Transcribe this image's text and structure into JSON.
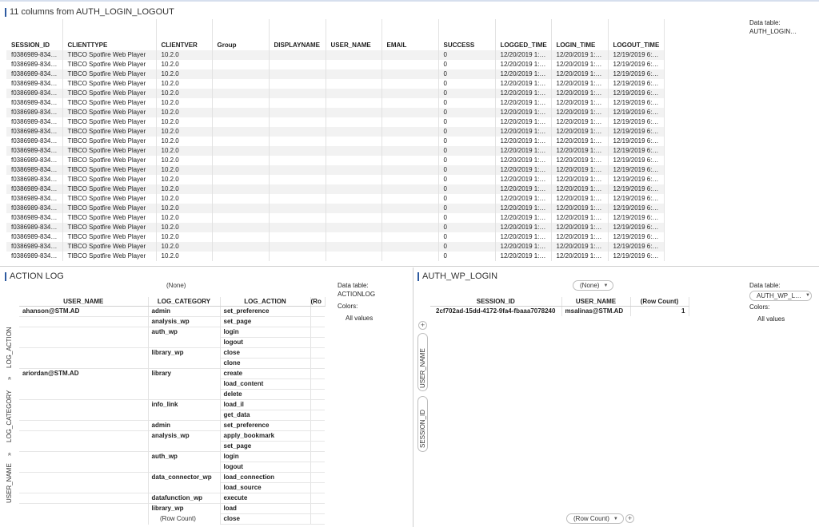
{
  "top": {
    "title": "11 columns from AUTH_LOGIN_LOGOUT",
    "data_table_label": "Data table:",
    "data_table_value": "AUTH_LOGIN…",
    "columns": [
      "SESSION_ID",
      "CLIENTTYPE",
      "CLIENTVER",
      "Group",
      "DISPLAYNAME",
      "USER_NAME",
      "EMAIL",
      "SUCCESS",
      "LOGGED_TIME",
      "LOGIN_TIME",
      "LOGOUT_TIME"
    ],
    "rows": [
      [
        "f0386989-834…",
        "TIBCO Spotfire Web Player",
        "10.2.0",
        "",
        "",
        "",
        "",
        "0",
        "12/20/2019 1:…",
        "12/20/2019 1:…",
        "12/19/2019 6:…"
      ],
      [
        "f0386989-834…",
        "TIBCO Spotfire Web Player",
        "10.2.0",
        "",
        "",
        "",
        "",
        "0",
        "12/20/2019 1:…",
        "12/20/2019 1:…",
        "12/19/2019 6:…"
      ],
      [
        "f0386989-834…",
        "TIBCO Spotfire Web Player",
        "10.2.0",
        "",
        "",
        "",
        "",
        "0",
        "12/20/2019 1:…",
        "12/20/2019 1:…",
        "12/19/2019 6:…"
      ],
      [
        "f0386989-834…",
        "TIBCO Spotfire Web Player",
        "10.2.0",
        "",
        "",
        "",
        "",
        "0",
        "12/20/2019 1:…",
        "12/20/2019 1:…",
        "12/19/2019 6:…"
      ],
      [
        "f0386989-834…",
        "TIBCO Spotfire Web Player",
        "10.2.0",
        "",
        "",
        "",
        "",
        "0",
        "12/20/2019 1:…",
        "12/20/2019 1:…",
        "12/19/2019 6:…"
      ],
      [
        "f0386989-834…",
        "TIBCO Spotfire Web Player",
        "10.2.0",
        "",
        "",
        "",
        "",
        "0",
        "12/20/2019 1:…",
        "12/20/2019 1:…",
        "12/19/2019 6:…"
      ],
      [
        "f0386989-834…",
        "TIBCO Spotfire Web Player",
        "10.2.0",
        "",
        "",
        "",
        "",
        "0",
        "12/20/2019 1:…",
        "12/20/2019 1:…",
        "12/19/2019 6:…"
      ],
      [
        "f0386989-834…",
        "TIBCO Spotfire Web Player",
        "10.2.0",
        "",
        "",
        "",
        "",
        "0",
        "12/20/2019 1:…",
        "12/20/2019 1:…",
        "12/19/2019 6:…"
      ],
      [
        "f0386989-834…",
        "TIBCO Spotfire Web Player",
        "10.2.0",
        "",
        "",
        "",
        "",
        "0",
        "12/20/2019 1:…",
        "12/20/2019 1:…",
        "12/19/2019 6:…"
      ],
      [
        "f0386989-834…",
        "TIBCO Spotfire Web Player",
        "10.2.0",
        "",
        "",
        "",
        "",
        "0",
        "12/20/2019 1:…",
        "12/20/2019 1:…",
        "12/19/2019 6:…"
      ],
      [
        "f0386989-834…",
        "TIBCO Spotfire Web Player",
        "10.2.0",
        "",
        "",
        "",
        "",
        "0",
        "12/20/2019 1:…",
        "12/20/2019 1:…",
        "12/19/2019 6:…"
      ],
      [
        "f0386989-834…",
        "TIBCO Spotfire Web Player",
        "10.2.0",
        "",
        "",
        "",
        "",
        "0",
        "12/20/2019 1:…",
        "12/20/2019 1:…",
        "12/19/2019 6:…"
      ],
      [
        "f0386989-834…",
        "TIBCO Spotfire Web Player",
        "10.2.0",
        "",
        "",
        "",
        "",
        "0",
        "12/20/2019 1:…",
        "12/20/2019 1:…",
        "12/19/2019 6:…"
      ],
      [
        "f0386989-834…",
        "TIBCO Spotfire Web Player",
        "10.2.0",
        "",
        "",
        "",
        "",
        "0",
        "12/20/2019 1:…",
        "12/20/2019 1:…",
        "12/19/2019 6:…"
      ],
      [
        "f0386989-834…",
        "TIBCO Spotfire Web Player",
        "10.2.0",
        "",
        "",
        "",
        "",
        "0",
        "12/20/2019 1:…",
        "12/20/2019 1:…",
        "12/19/2019 6:…"
      ],
      [
        "f0386989-834…",
        "TIBCO Spotfire Web Player",
        "10.2.0",
        "",
        "",
        "",
        "",
        "0",
        "12/20/2019 1:…",
        "12/20/2019 1:…",
        "12/19/2019 6:…"
      ],
      [
        "f0386989-834…",
        "TIBCO Spotfire Web Player",
        "10.2.0",
        "",
        "",
        "",
        "",
        "0",
        "12/20/2019 1:…",
        "12/20/2019 1:…",
        "12/19/2019 6:…"
      ],
      [
        "f0386989-834…",
        "TIBCO Spotfire Web Player",
        "10.2.0",
        "",
        "",
        "",
        "",
        "0",
        "12/20/2019 1:…",
        "12/20/2019 1:…",
        "12/19/2019 6:…"
      ],
      [
        "f0386989-834…",
        "TIBCO Spotfire Web Player",
        "10.2.0",
        "",
        "",
        "",
        "",
        "0",
        "12/20/2019 1:…",
        "12/20/2019 1:…",
        "12/19/2019 6:…"
      ],
      [
        "f0386989-834…",
        "TIBCO Spotfire Web Player",
        "10.2.0",
        "",
        "",
        "",
        "",
        "0",
        "12/20/2019 1:…",
        "12/20/2019 1:…",
        "12/19/2019 6:…"
      ],
      [
        "f0386989-834…",
        "TIBCO Spotfire Web Player",
        "10.2.0",
        "",
        "",
        "",
        "",
        "0",
        "12/20/2019 1:…",
        "12/20/2019 1:…",
        "12/19/2019 6:…"
      ],
      [
        "f0386989-834…",
        "TIBCO Spotfire Web Player",
        "10.2.0",
        "",
        "",
        "",
        "",
        "0",
        "12/20/2019 1:…",
        "12/20/2019 1:…",
        "12/19/2019 6:…"
      ]
    ]
  },
  "action_log": {
    "title": "ACTION LOG",
    "column_selector": "(None)",
    "columns": [
      "USER_NAME",
      "LOG_CATEGORY",
      "LOG_ACTION",
      "(Ro"
    ],
    "axis_labels": [
      "LOG_ACTION",
      "»",
      "LOG_CATEGORY",
      "»",
      "USER_NAME"
    ],
    "rows": [
      [
        "ahanson@STM.AD",
        "admin",
        "set_preference"
      ],
      [
        "",
        "analysis_wp",
        "set_page"
      ],
      [
        "",
        "auth_wp",
        "login"
      ],
      [
        "",
        "",
        "logout"
      ],
      [
        "",
        "library_wp",
        "close"
      ],
      [
        "",
        "",
        "clone"
      ],
      [
        "ariordan@STM.AD",
        "library",
        "create"
      ],
      [
        "",
        "",
        "load_content"
      ],
      [
        "",
        "",
        "delete"
      ],
      [
        "",
        "info_link",
        "load_il"
      ],
      [
        "",
        "",
        "get_data"
      ],
      [
        "",
        "admin",
        "set_preference"
      ],
      [
        "",
        "analysis_wp",
        "apply_bookmark"
      ],
      [
        "",
        "",
        "set_page"
      ],
      [
        "",
        "auth_wp",
        "login"
      ],
      [
        "",
        "",
        "logout"
      ],
      [
        "",
        "data_connector_wp",
        "load_connection"
      ],
      [
        "",
        "",
        "load_source"
      ],
      [
        "",
        "datafunction_wp",
        "execute"
      ],
      [
        "",
        "library_wp",
        "load"
      ],
      [
        "",
        "",
        "close"
      ]
    ],
    "value_selector": "(Row Count)",
    "data_table_label": "Data table:",
    "data_table_value": "ACTIONLOG",
    "colors_label": "Colors:",
    "colors_value": "All values"
  },
  "wp_login": {
    "title": "AUTH_WP_LOGIN",
    "column_selector": "(None)",
    "columns": [
      "SESSION_ID",
      "USER_NAME",
      "(Row Count)"
    ],
    "rows": [
      [
        "2cf702ad-15dd-4172-9fa4-fbaaa7078240",
        "msalinas@STM.AD",
        "1"
      ]
    ],
    "axis_labels": [
      "USER_NAME",
      "SESSION_ID"
    ],
    "value_selector": "(Row Count)",
    "data_table_label": "Data table:",
    "data_table_value": "AUTH_WP_L…",
    "colors_label": "Colors:",
    "colors_value": "All values"
  }
}
